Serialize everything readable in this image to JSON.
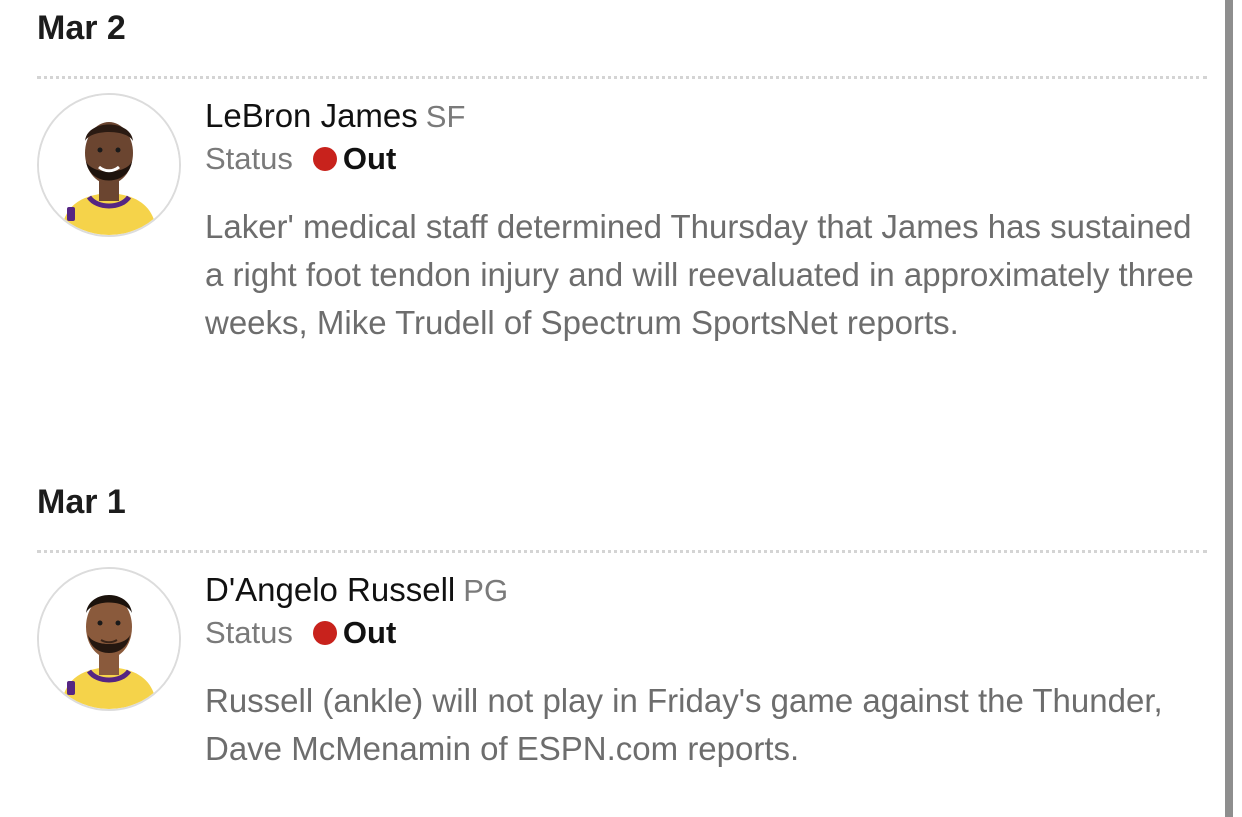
{
  "entries": [
    {
      "date": "Mar 2",
      "player": "LeBron James",
      "position": "SF",
      "status_label": "Status",
      "status_value": "Out",
      "note": "Laker' medical staff determined Thursday that James has sustained a right foot tendon injury and will reevaluated in approximately three weeks, Mike Trudell of Spectrum SportsNet reports."
    },
    {
      "date": "Mar 1",
      "player": "D'Angelo Russell",
      "position": "PG",
      "status_label": "Status",
      "status_value": "Out",
      "note": "Russell (ankle) will not play in Friday's game against the Thunder, Dave McMenamin of ESPN.com reports."
    }
  ],
  "colors": {
    "status_out": "#c8221c",
    "jersey": "#f5d34a",
    "jersey_trim": "#552583"
  }
}
